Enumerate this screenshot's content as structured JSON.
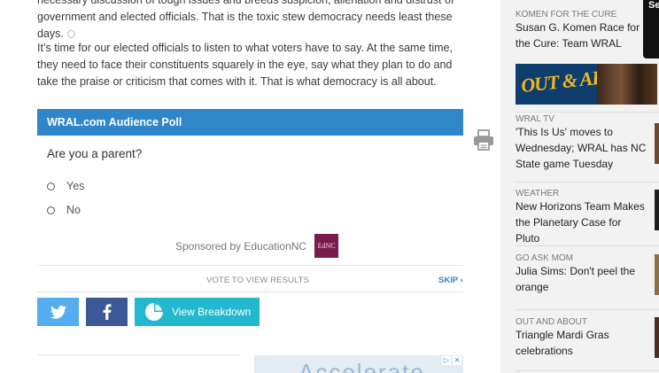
{
  "article": {
    "paragraph1": "necessary discussion of tough issues and breeds suspicion, alienation and distrust of government and elected officials. That is the toxic stew democracy needs least these days.",
    "paragraph2": "It’s time for our elected officials to listen to what voters have to say. At the same time, they need to face their constituents squarely in the eye, say what they plan to do and take the praise or criticism that comes with it. That is what democracy is all about."
  },
  "poll": {
    "header": "WRAL.com Audience Poll",
    "question": "Are you a parent?",
    "options": [
      "Yes",
      "No"
    ],
    "sponsor_label": "Sponsored by EducationNC",
    "sponsor_logo_text": "EdNC",
    "vote_label": "VOTE TO VIEW RESULTS",
    "skip_label": "SKIP ›",
    "breakdown_label": "View Breakdown"
  },
  "ad": {
    "text": "Accelerate"
  },
  "sidebar": {
    "items": [
      {
        "category": "KOMEN FOR THE CURE",
        "headline": "Susan G. Komen Race for the Cure: Team WRAL"
      },
      {
        "category": "WRAL TV",
        "headline": "'This Is Us' moves to Wednesday; WRAL has NC State game Tuesday"
      },
      {
        "category": "WEATHER",
        "headline": "New Horizons Team Makes the Planetary Case for Pluto"
      },
      {
        "category": "GO ASK MOM",
        "headline": "Julia Sims: Don't peel the orange"
      },
      {
        "category": "OUT AND ABOUT",
        "headline": "Triangle Mardi Gras celebrations"
      }
    ],
    "banner_text": "OUT & ABOUT",
    "top_ad_text": "Se"
  },
  "colors": {
    "poll_header": "#2f86c9",
    "twitter": "#55acee",
    "facebook": "#3b5998",
    "breakdown": "#23b8d0",
    "sponsor_logo": "#7a1c4b",
    "sidebar_bg": "#f2f2f2"
  },
  "icons": [
    "print-icon",
    "twitter-icon",
    "facebook-icon",
    "pie-chart-icon",
    "radio-icon",
    "ad-choices-icon",
    "close-icon"
  ]
}
